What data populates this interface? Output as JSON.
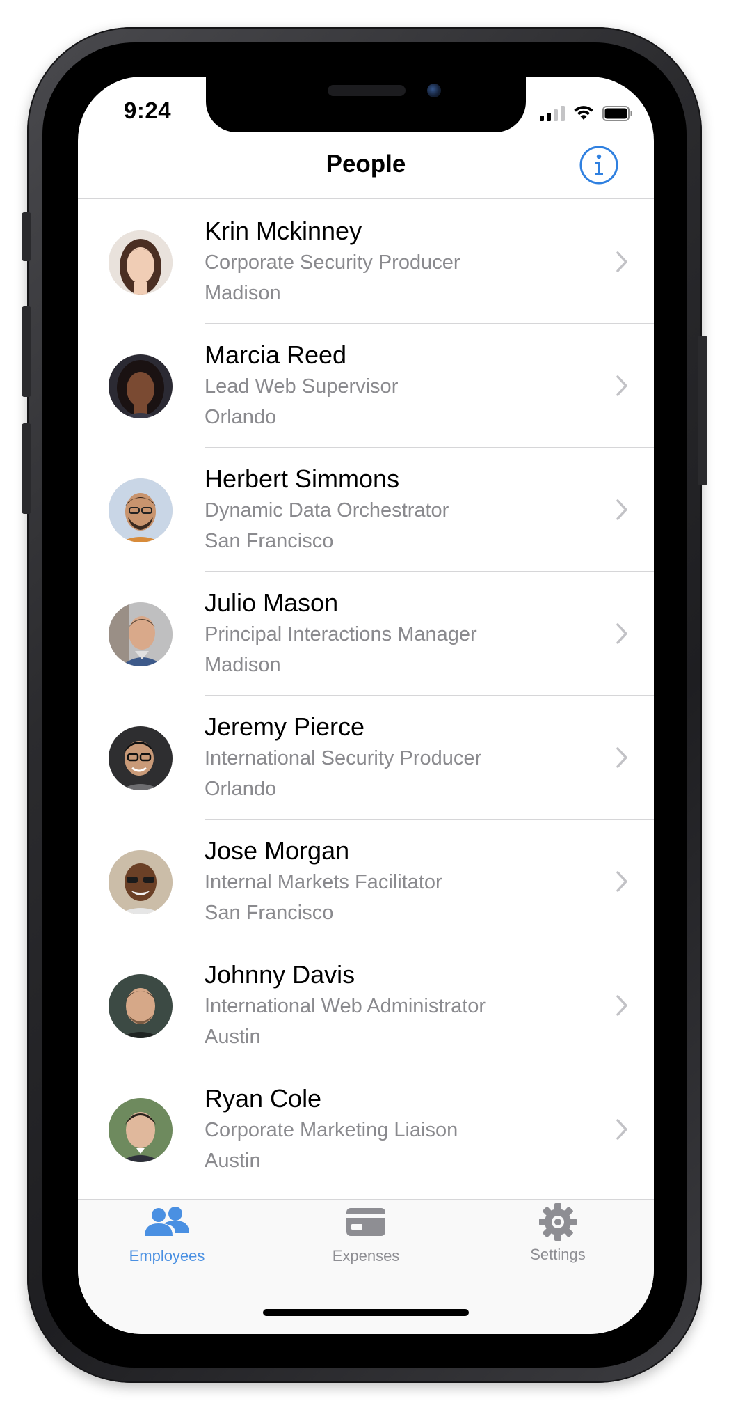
{
  "status_bar": {
    "time": "9:24",
    "icons": [
      "signal-icon",
      "wifi-icon",
      "battery-icon"
    ]
  },
  "nav": {
    "title": "People",
    "info_icon": "info-icon",
    "accent": "#2f80e0"
  },
  "people": [
    {
      "name": "Krin Mckinney",
      "title": "Corporate Security Producer",
      "city": "Madison"
    },
    {
      "name": "Marcia Reed",
      "title": "Lead Web Supervisor",
      "city": "Orlando"
    },
    {
      "name": "Herbert Simmons",
      "title": "Dynamic Data Orchestrator",
      "city": "San Francisco"
    },
    {
      "name": "Julio Mason",
      "title": "Principal Interactions Manager",
      "city": "Madison"
    },
    {
      "name": "Jeremy Pierce",
      "title": "International Security Producer",
      "city": "Orlando"
    },
    {
      "name": "Jose Morgan",
      "title": "Internal Markets Facilitator",
      "city": "San Francisco"
    },
    {
      "name": "Johnny Davis",
      "title": "International Web Administrator",
      "city": "Austin"
    },
    {
      "name": "Ryan Cole",
      "title": "Corporate Marketing Liaison",
      "city": "Austin"
    }
  ],
  "tabs": [
    {
      "label": "Employees",
      "icon": "people-icon",
      "active": true
    },
    {
      "label": "Expenses",
      "icon": "card-icon",
      "active": false
    },
    {
      "label": "Settings",
      "icon": "gear-icon",
      "active": false
    }
  ],
  "colors": {
    "active_tab": "#4a90e2",
    "inactive_tab": "#8e8e93",
    "secondary_text": "#8a8a8e",
    "separator": "#d6d6d8"
  }
}
